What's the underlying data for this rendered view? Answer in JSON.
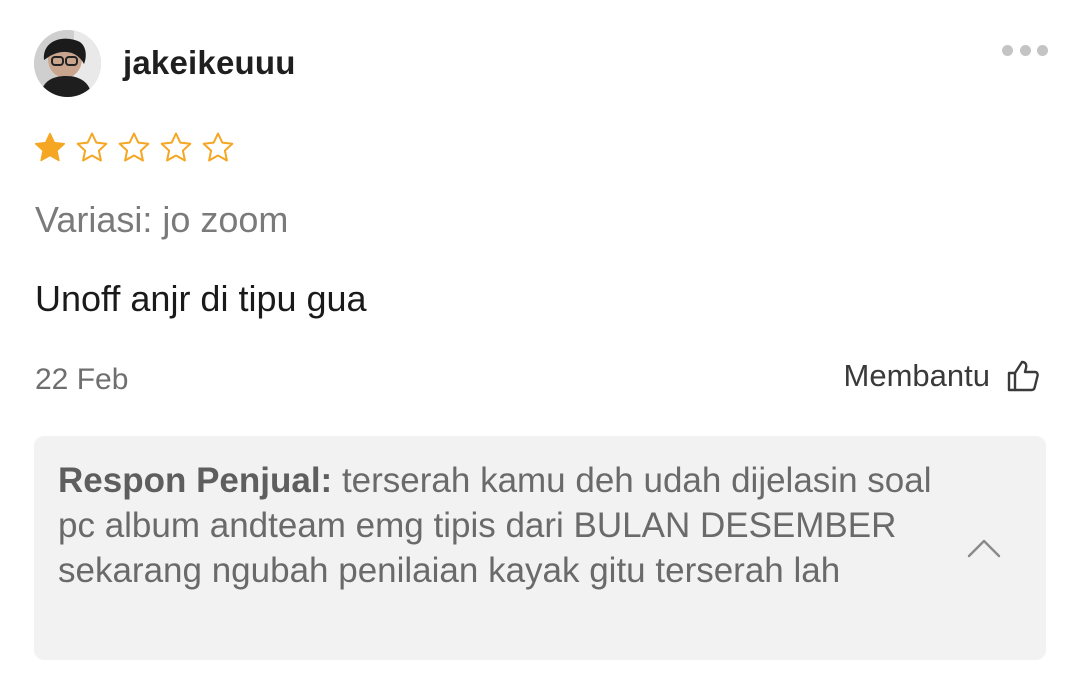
{
  "review": {
    "username": "jakeikeuuu",
    "rating": 1,
    "rating_max": 5,
    "variation": "Variasi: jo zoom",
    "text": "Unoff anjr di tipu gua",
    "date": "22 Feb",
    "helpful_label": "Membantu"
  },
  "seller_response": {
    "label": "Respon Penjual:",
    "text": " terserah kamu deh udah dijelasin soal pc album andteam emg tipis dari BULAN DESEMBER sekarang ngubah penilaian kayak gitu terserah lah"
  },
  "colors": {
    "star_filled": "#F5A623",
    "star_empty": "#F5A623",
    "reply_background": "#F2F2F2"
  },
  "icons": {
    "more": "more-horizontal-icon",
    "helpful": "thumbs-up-icon",
    "collapse": "chevron-up-icon",
    "star": "star-icon"
  }
}
